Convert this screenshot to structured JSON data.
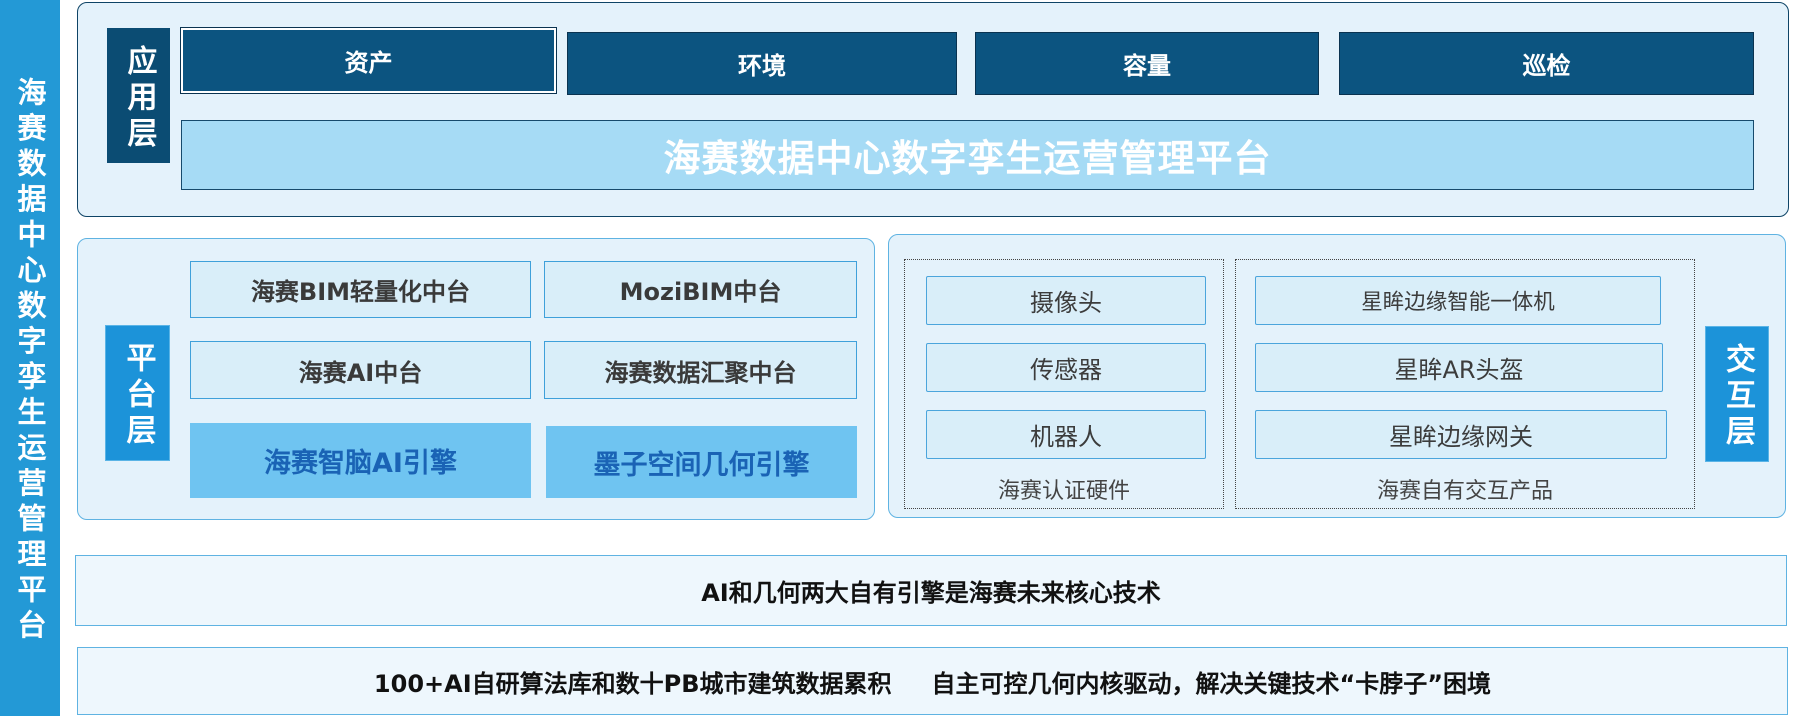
{
  "sidebar": {
    "title": "海赛数据中心数字孪生运营管理平台"
  },
  "app_layer": {
    "label": "应用层",
    "modules": [
      {
        "label": "资产"
      },
      {
        "label": "环境"
      },
      {
        "label": "容量"
      },
      {
        "label": "巡检"
      }
    ],
    "platform": "海赛数据中心数字孪生运营管理平台"
  },
  "platform_layer": {
    "label": "平台层",
    "platforms": [
      "海赛BIM轻量化中台",
      "MoziBIM中台",
      "海赛AI中台",
      "海赛数据汇聚中台"
    ],
    "engines": [
      "海赛智脑AI引擎",
      "墨子空间几何引擎"
    ]
  },
  "interaction_layer": {
    "label": "交互层",
    "certified_hardware": {
      "items": [
        "摄像头",
        "传感器",
        "机器人"
      ],
      "caption": "海赛认证硬件"
    },
    "own_products": {
      "items": [
        "星眸边缘智能一体机",
        "星眸AR头盔",
        "星眸边缘网关"
      ],
      "caption": "海赛自有交互产品"
    }
  },
  "summary": "AI和几何两大自有引擎是海赛未来核心技术",
  "footer": {
    "left": "100+AI自研算法库和数十PB城市建筑数据累积",
    "right": "自主可控几何内核驱动，解决关键技术“卡脖子”困境"
  },
  "theme": {
    "sidebar": "#2399d6",
    "panel-bg": "#e4f2fb",
    "navy": "#0b4c73",
    "navy-border": "#0e4466",
    "blue": "#1c93d9",
    "module": "#0c5480",
    "big-bar": "#a6dbf5",
    "box-bg": "#d9eef9",
    "box-border": "#3fa0da",
    "engine-bg": "#6fc4f1",
    "engine-text": "#1a63b5",
    "light-border": "#5fb3e2",
    "bar-bg": "#eef7fd"
  }
}
